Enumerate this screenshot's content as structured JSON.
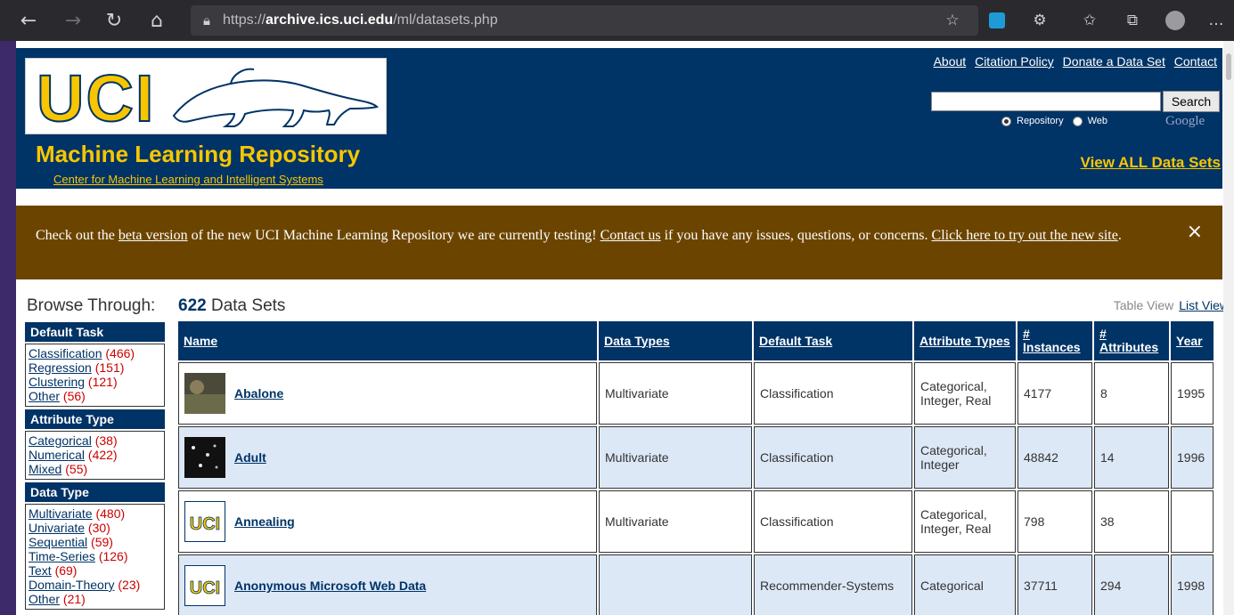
{
  "browser": {
    "url_scheme": "https://",
    "url_host": "archive.ics.uci.edu",
    "url_path": "/ml/datasets.php"
  },
  "header": {
    "logo_text": "UCI",
    "repo_title": "Machine Learning Repository",
    "subtitle_link": "Center for Machine Learning and Intelligent Systems",
    "top_links": [
      "About",
      "Citation Policy",
      "Donate a Data Set",
      "Contact"
    ],
    "search_button": "Search",
    "radio_repository": "Repository",
    "radio_web": "Web",
    "google_label": "Google",
    "view_all": "View ALL Data Sets"
  },
  "banner": {
    "t1": "Check out the ",
    "l1": "beta version",
    "t2": " of the new UCI Machine Learning Repository we are currently testing! ",
    "l2": "Contact us",
    "t3": " if you have any issues, questions, or concerns. ",
    "l3": "Click here to try out the new site",
    "t4": ".",
    "close": "×"
  },
  "browse": {
    "title": "Browse Through:",
    "count": "622",
    "count_suffix": " Data Sets",
    "table_view": "Table View",
    "list_view": "List View"
  },
  "sidebar": {
    "default_task": {
      "title": "Default Task",
      "items": [
        {
          "label": "Classification",
          "count": " (466)"
        },
        {
          "label": "Regression",
          "count": " (151)"
        },
        {
          "label": "Clustering",
          "count": " (121)"
        },
        {
          "label": "Other",
          "count": " (56)"
        }
      ]
    },
    "attribute_type": {
      "title": "Attribute Type",
      "items": [
        {
          "label": "Categorical",
          "count": " (38)"
        },
        {
          "label": "Numerical",
          "count": " (422)"
        },
        {
          "label": "Mixed",
          "count": " (55)"
        }
      ]
    },
    "data_type": {
      "title": "Data Type",
      "items": [
        {
          "label": "Multivariate",
          "count": " (480)"
        },
        {
          "label": "Univariate",
          "count": " (30)"
        },
        {
          "label": "Sequential",
          "count": " (59)"
        },
        {
          "label": "Time-Series",
          "count": " (126)"
        },
        {
          "label": "Text",
          "count": " (69)"
        },
        {
          "label": "Domain-Theory",
          "count": " (23)"
        },
        {
          "label": "Other",
          "count": " (21)"
        }
      ]
    }
  },
  "table": {
    "headers": [
      "Name",
      "Data Types",
      "Default Task",
      "Attribute Types",
      "# Instances",
      "# Attributes",
      "Year"
    ],
    "rows": [
      {
        "name": "Abalone",
        "data_types": "Multivariate",
        "task": "Classification",
        "attr_types": "Categorical, Integer, Real",
        "instances": "4177",
        "attributes": "8",
        "year": "1995",
        "thumb": "photo-abalone"
      },
      {
        "name": "Adult",
        "data_types": "Multivariate",
        "task": "Classification",
        "attr_types": "Categorical, Integer",
        "instances": "48842",
        "attributes": "14",
        "year": "1996",
        "thumb": "photo-adult"
      },
      {
        "name": "Annealing",
        "data_types": "Multivariate",
        "task": "Classification",
        "attr_types": "Categorical, Integer, Real",
        "instances": "798",
        "attributes": "38",
        "year": "",
        "thumb": "uci-logo"
      },
      {
        "name": "Anonymous Microsoft Web Data",
        "data_types": "",
        "task": "Recommender-Systems",
        "attr_types": "Categorical",
        "instances": "37711",
        "attributes": "294",
        "year": "1998",
        "thumb": "uci-logo"
      }
    ]
  },
  "colors": {
    "navy": "#003366",
    "gold": "#f7c600",
    "banner_brown": "#6b4500",
    "alt_row": "#dde8f7",
    "count_red": "#cc0000"
  }
}
